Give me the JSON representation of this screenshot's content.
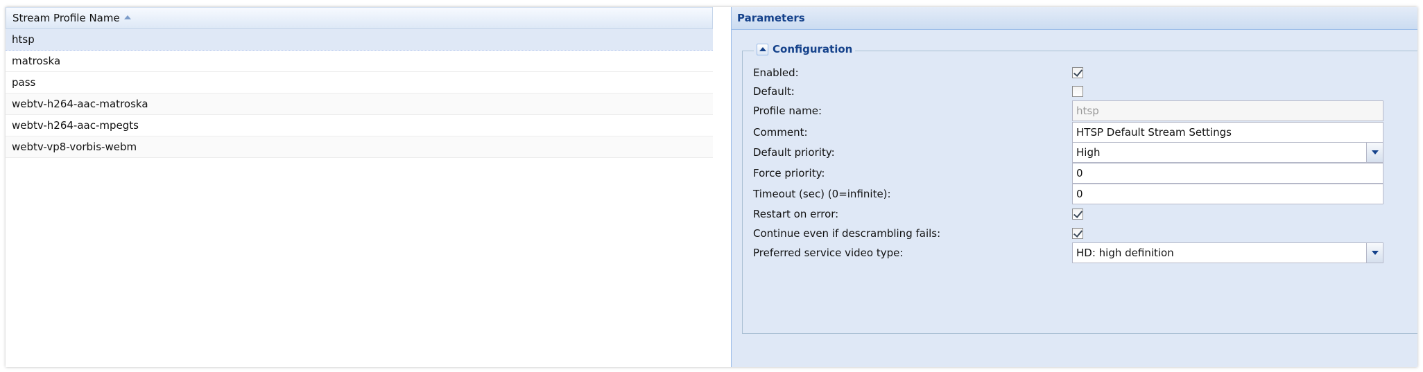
{
  "grid": {
    "column_header": "Stream Profile Name",
    "rows": [
      {
        "name": "htsp",
        "selected": true
      },
      {
        "name": "matroska",
        "selected": false
      },
      {
        "name": "pass",
        "selected": false
      },
      {
        "name": "webtv-h264-aac-matroska",
        "selected": false
      },
      {
        "name": "webtv-h264-aac-mpegts",
        "selected": false
      },
      {
        "name": "webtv-vp8-vorbis-webm",
        "selected": false
      }
    ]
  },
  "panel": {
    "title": "Parameters",
    "fieldset_title": "Configuration",
    "fields": {
      "enabled": {
        "label": "Enabled:",
        "checked": true
      },
      "default": {
        "label": "Default:",
        "checked": false
      },
      "profile_name": {
        "label": "Profile name:",
        "value": "htsp",
        "disabled": true
      },
      "comment": {
        "label": "Comment:",
        "value": "HTSP Default Stream Settings"
      },
      "default_priority": {
        "label": "Default priority:",
        "value": "High"
      },
      "force_priority": {
        "label": "Force priority:",
        "value": "0"
      },
      "timeout": {
        "label": "Timeout (sec) (0=infinite):",
        "value": "0"
      },
      "restart_on_error": {
        "label": "Restart on error:",
        "checked": true
      },
      "continue_descrambling": {
        "label": "Continue even if descrambling fails:",
        "checked": true
      },
      "preferred_video_type": {
        "label": "Preferred service video type:",
        "value": "HD: high definition"
      }
    }
  },
  "icons": {
    "sort": "sort-ascending-icon",
    "collapse": "collapse-up-icon",
    "dropdown": "chevron-down-icon"
  },
  "colors": {
    "panel_bg": "#dfe8f6",
    "header_text": "#15428b",
    "selected_row": "#dfe8f6"
  }
}
